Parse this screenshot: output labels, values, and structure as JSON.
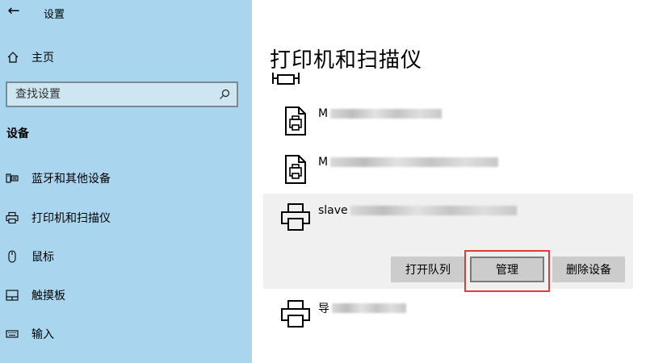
{
  "window": {
    "title": "设置"
  },
  "sidebar": {
    "home_label": "主页",
    "search_placeholder": "查找设置",
    "section_title": "设备",
    "items": [
      {
        "label": "蓝牙和其他设备",
        "icon": "bluetooth-devices-icon"
      },
      {
        "label": "打印机和扫描仪",
        "icon": "printer-icon"
      },
      {
        "label": "鼠标",
        "icon": "mouse-icon"
      },
      {
        "label": "触摸板",
        "icon": "touchpad-icon"
      },
      {
        "label": "输入",
        "icon": "keyboard-icon"
      }
    ]
  },
  "main": {
    "title": "打印机和扫描仪",
    "printers": [
      {
        "name_prefix": "M",
        "icon": "printer-document-icon"
      },
      {
        "name_prefix": "M",
        "icon": "printer-document-icon"
      },
      {
        "name_prefix": "slave",
        "icon": "printer-icon",
        "selected": true
      },
      {
        "name_prefix": "导",
        "icon": "printer-icon"
      }
    ],
    "actions": {
      "open_queue": "打开队列",
      "manage": "管理",
      "remove_device": "删除设备"
    }
  },
  "colors": {
    "sidebar_bg": "#a9d6ee",
    "selected_row_bg": "#f0f0f0",
    "button_bg": "#cccccc",
    "highlight_border": "#e53935"
  }
}
